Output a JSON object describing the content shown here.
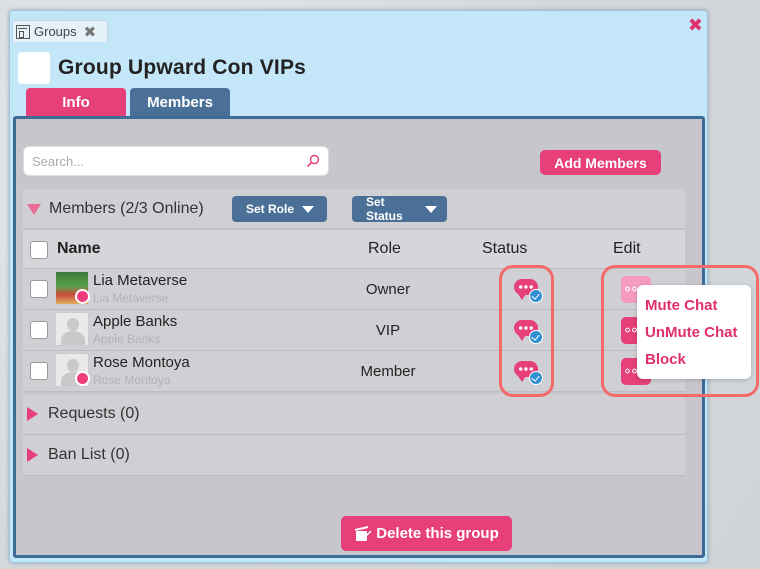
{
  "window": {
    "tab_label": "Groups",
    "title": "Group Upward Con VIPs"
  },
  "tabs": [
    {
      "label": "Info"
    },
    {
      "label": "Members"
    }
  ],
  "search": {
    "placeholder": "Search..."
  },
  "add_members_label": "Add Members",
  "members_section": {
    "label": "Members (2/3 Online)",
    "set_role_label": "Set Role",
    "set_status_label": "Set Status"
  },
  "table": {
    "headers": {
      "name": "Name",
      "role": "Role",
      "status": "Status",
      "edit": "Edit"
    },
    "rows": [
      {
        "name": "Lia Metaverse",
        "sub": "Lia Metaverse",
        "role": "Owner",
        "online": true,
        "photo": true
      },
      {
        "name": "Apple Banks",
        "sub": "Apple Banks",
        "role": "VIP",
        "online": false,
        "photo": false
      },
      {
        "name": "Rose Montoya",
        "sub": "Rose Montoya",
        "role": "Member",
        "online": true,
        "photo": false
      }
    ]
  },
  "requests_label": "Requests (0)",
  "ban_list_label": "Ban List (0)",
  "context_menu": [
    "Mute Chat",
    "UnMute Chat",
    "Block"
  ],
  "delete_label": "Delete this group",
  "colors": {
    "accent_pink": "#e63f79",
    "accent_blue": "#4b7098",
    "highlight_red": "#f36a6a"
  }
}
